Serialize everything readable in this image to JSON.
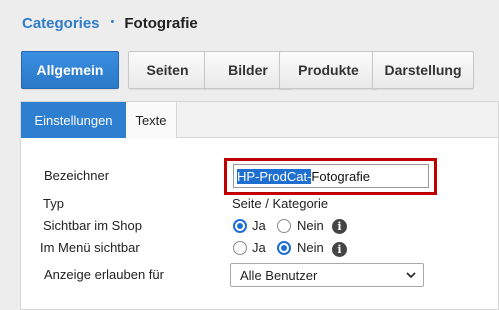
{
  "breadcrumb": {
    "root": "Categories",
    "separator": "•",
    "current": "Fotografie"
  },
  "main_tabs": [
    {
      "label": "Allgemein",
      "active": true
    },
    {
      "label": "Seiten",
      "active": false
    },
    {
      "label": "Bilder",
      "active": false
    },
    {
      "label": "Produkte",
      "active": false
    },
    {
      "label": "Darstellung",
      "active": false
    }
  ],
  "sub_tabs": [
    {
      "label": "Einstellungen",
      "active": true
    },
    {
      "label": "Texte",
      "active": false
    }
  ],
  "form": {
    "bezeichner": {
      "label": "Bezeichner",
      "value_selected": "HP-ProdCat-",
      "value_rest": "Fotografie"
    },
    "typ": {
      "label": "Typ",
      "value": "Seite / Kategorie"
    },
    "sichtbar_shop": {
      "label": "Sichtbar im Shop",
      "option_yes": "Ja",
      "option_no": "Nein",
      "selected": "Ja"
    },
    "menu_sichtbar": {
      "label": "Im Menü sichtbar",
      "option_yes": "Ja",
      "option_no": "Nein",
      "selected": "Nein"
    },
    "anzeige": {
      "label": "Anzeige erlauben für",
      "value": "Alle Benutzer"
    }
  },
  "colors": {
    "accent": "#2e7fd0",
    "highlight": "#c00000"
  }
}
